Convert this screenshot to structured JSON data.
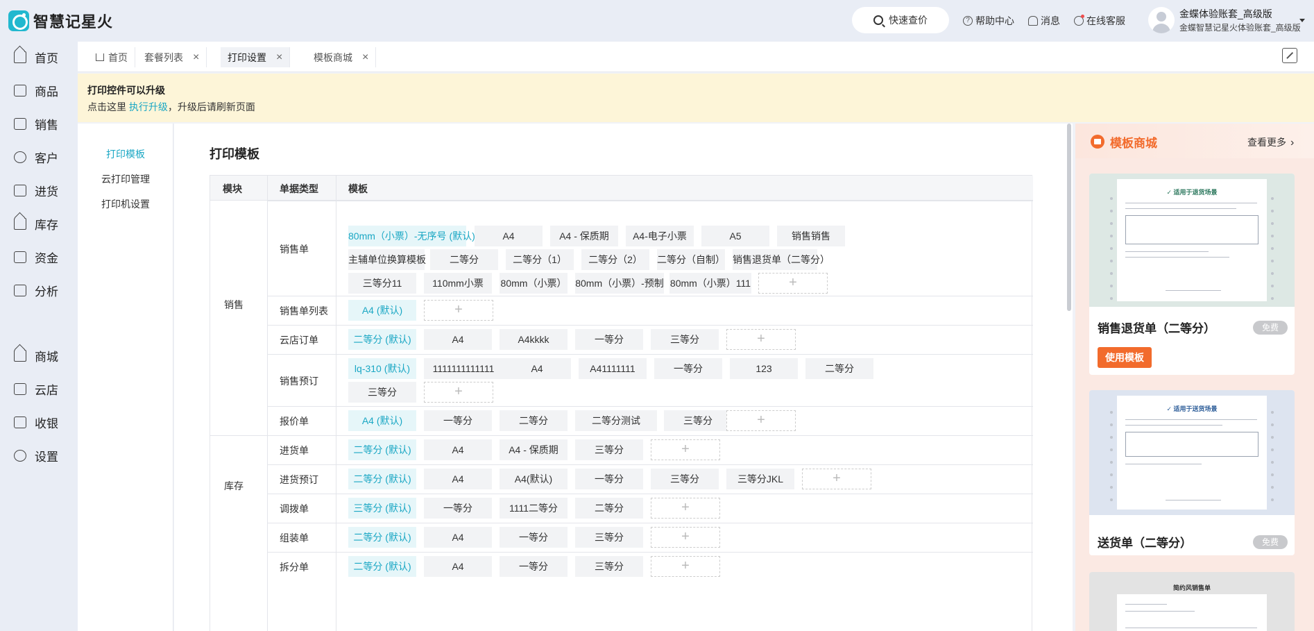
{
  "app": {
    "logo_text": "智慧记星火",
    "quick_price": "快速查价",
    "help": "帮助中心",
    "messages": "消息",
    "online_service": "在线客服",
    "account_name": "金蝶体验账套_高级版",
    "account_sub": "金蝶智慧记星火体验账套_高级版"
  },
  "nav": [
    "首页",
    "商品",
    "销售",
    "客户",
    "进货",
    "库存",
    "资金",
    "分析",
    "商城",
    "云店",
    "收银",
    "设置"
  ],
  "tabs": [
    {
      "label": "首页",
      "closable": false
    },
    {
      "label": "套餐列表",
      "closable": true
    },
    {
      "label": "打印设置",
      "closable": true,
      "active": true
    },
    {
      "label": "模板商城",
      "closable": true
    }
  ],
  "notice": {
    "title": "打印控件可以升级",
    "text_before": "点击这里 ",
    "link": "执行升级",
    "text_after": "，升级后请刷新页面"
  },
  "subnav": [
    {
      "label": "打印模板",
      "active": true
    },
    {
      "label": "云打印管理"
    },
    {
      "label": "打印机设置"
    }
  ],
  "main": {
    "title": "打印模板",
    "headers": [
      "模块",
      "单据类型",
      "模板"
    ],
    "modules": [
      "销售",
      "库存"
    ],
    "rows": [
      {
        "type": "销售单",
        "templates": [
          "80mm（小票）-无序号 (默认)",
          "A4",
          "A4 - 保质期",
          "A4-电子小票",
          "A5",
          "销售销售",
          "主辅单位换算模板",
          "二等分",
          "二等分（1）",
          "二等分（2）",
          "二等分（自制）",
          "销售退货单（二等分）",
          "三等分11",
          "110mm小票",
          "80mm（小票）",
          "80mm（小票）-预制",
          "80mm（小票）111"
        ]
      },
      {
        "type": "销售单列表",
        "templates": [
          "A4 (默认)"
        ]
      },
      {
        "type": "云店订单",
        "templates": [
          "二等分 (默认)",
          "A4",
          "A4kkkk",
          "一等分",
          "三等分"
        ]
      },
      {
        "type": "销售预订",
        "templates": [
          "lq-310 (默认)",
          "1111111111111",
          "A4",
          "A41111111",
          "一等分",
          "123",
          "二等分",
          "三等分"
        ]
      },
      {
        "type": "报价单",
        "templates": [
          "A4 (默认)",
          "一等分",
          "二等分",
          "二等分测试",
          "三等分"
        ]
      },
      {
        "type": "进货单",
        "templates": [
          "二等分 (默认)",
          "A4",
          "A4 - 保质期",
          "三等分"
        ]
      },
      {
        "type": "进货预订",
        "templates": [
          "二等分 (默认)",
          "A4",
          "A4(默认)",
          "一等分",
          "三等分",
          "三等分JKL"
        ]
      },
      {
        "type": "调拨单",
        "templates": [
          "三等分 (默认)",
          "一等分",
          "1111二等分",
          "二等分"
        ]
      },
      {
        "type": "组装单",
        "templates": [
          "二等分 (默认)",
          "A4",
          "一等分",
          "三等分"
        ]
      },
      {
        "type": "拆分单",
        "templates": [
          "二等分 (默认)",
          "A4",
          "一等分",
          "三等分"
        ]
      }
    ],
    "add_symbol": "+"
  },
  "store": {
    "title": "模板商城",
    "more": "查看更多",
    "cards": [
      {
        "name": "销售退货单（二等分）",
        "badge": "免费",
        "button": "使用模板",
        "preview_label": "✓ 适用于退货场景"
      },
      {
        "name": "送货单（二等分）",
        "badge": "免费",
        "preview_label": "✓ 适用于送货场景"
      },
      {
        "preview_label": "简约风销售单"
      }
    ]
  },
  "colors": {
    "accent": "#1aa7c4",
    "orange": "#f26b2c",
    "notice_bg": "#fdf5d8"
  }
}
